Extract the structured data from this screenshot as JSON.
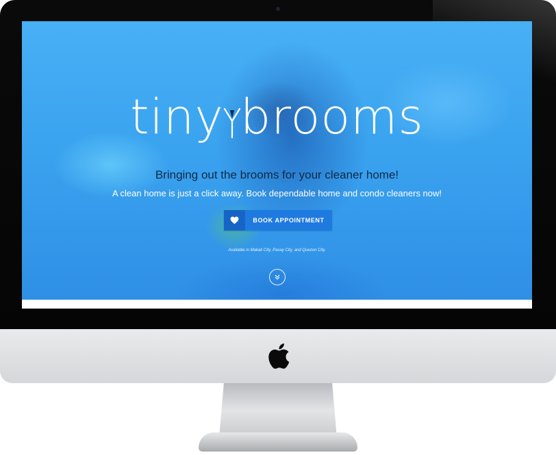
{
  "hero": {
    "logo_text_left": "tiny",
    "logo_text_right": "brooms",
    "tagline": "Bringing out the brooms for your cleaner home!",
    "subline": "A clean home is just a click away. Book dependable home and condo cleaners now!",
    "cta_label": "BOOK APPOINTMENT",
    "cta_icon": "heart-icon",
    "availability": "Available in Makati City, Pasay City, and Quezon City.",
    "scroll_icon": "double-chevron-down-icon"
  },
  "device": {
    "type": "iMac",
    "logo_icon": "apple-logo-icon"
  },
  "colors": {
    "hero_blue": "#3aa5f0",
    "cta_blue": "#1f7ae0",
    "cta_icon_blue": "#1665c6",
    "tagline_text": "#102a45"
  }
}
